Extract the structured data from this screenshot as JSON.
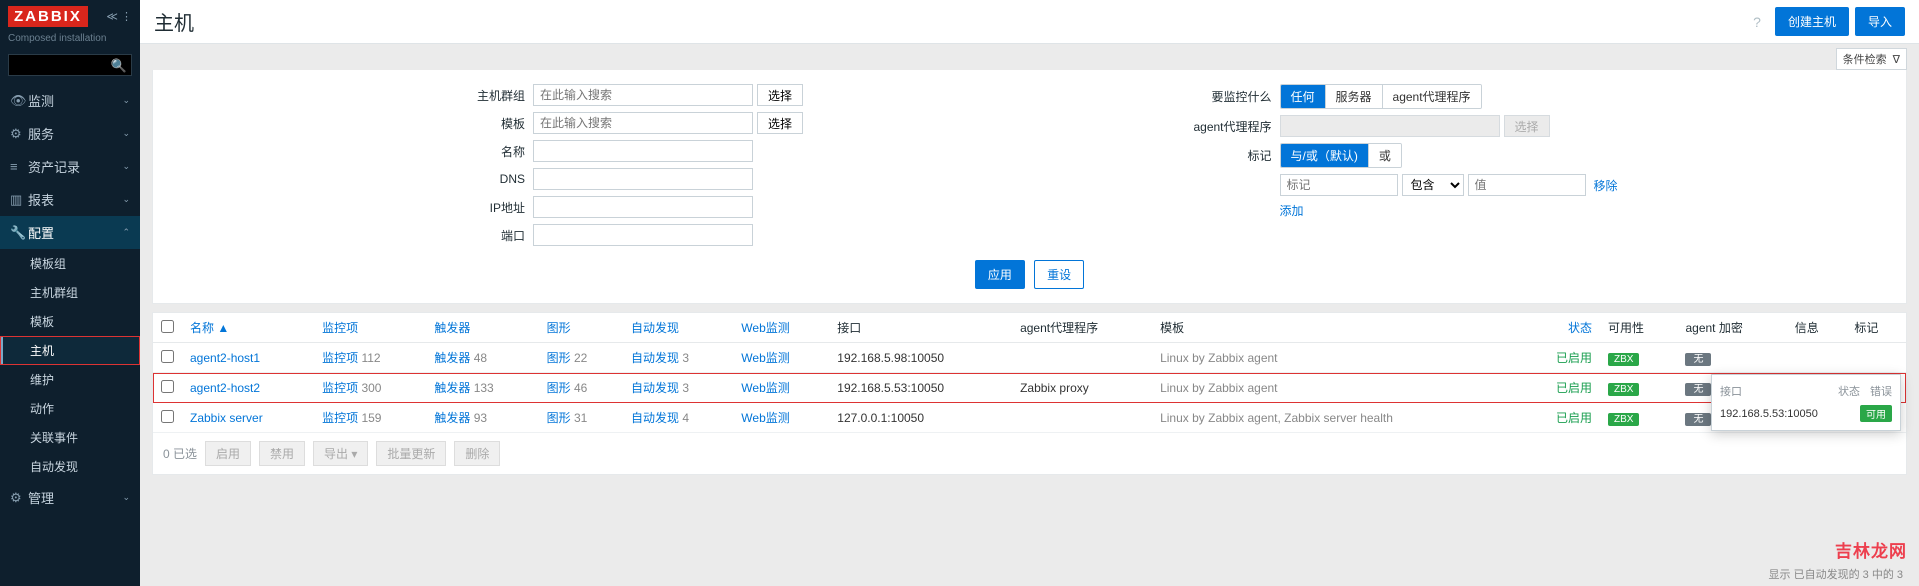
{
  "brand": {
    "logo": "ZABBIX",
    "subtitle": "Composed installation"
  },
  "sidebar": {
    "search_placeholder": "",
    "items": [
      {
        "icon": "👁",
        "label": "监测"
      },
      {
        "icon": "⚙",
        "label": "服务"
      },
      {
        "icon": "≡",
        "label": "资产记录"
      },
      {
        "icon": "▥",
        "label": "报表"
      },
      {
        "icon": "🔧",
        "label": "配置",
        "expanded": true
      },
      {
        "icon": "⚙",
        "label": "管理"
      }
    ],
    "config_children": [
      "模板组",
      "主机群组",
      "模板",
      "主机",
      "维护",
      "动作",
      "关联事件",
      "自动发现"
    ]
  },
  "header": {
    "title": "主机",
    "create": "创建主机",
    "import": "导入",
    "filter_label": "条件检索"
  },
  "filter": {
    "left": {
      "hostgroup": "主机群组",
      "placeholder": "在此输入搜索",
      "select": "选择",
      "template": "模板",
      "name": "名称",
      "dns": "DNS",
      "ip": "IP地址",
      "port": "端口"
    },
    "right": {
      "monitor": "要监控什么",
      "seg1": [
        "任何",
        "服务器",
        "agent代理程序"
      ],
      "proxy": "agent代理程序",
      "proxy_select": "选择",
      "tags": "标记",
      "seg2": [
        "与/或（默认)",
        "或"
      ],
      "tag_ph": "标记",
      "op": "包含",
      "val_ph": "值",
      "remove": "移除",
      "add": "添加"
    },
    "apply": "应用",
    "reset": "重设"
  },
  "table": {
    "cols": [
      "",
      "名称 ▲",
      "监控项",
      "触发器",
      "图形",
      "自动发现",
      "Web监测",
      "接口",
      "agent代理程序",
      "模板",
      "状态",
      "可用性",
      "agent 加密",
      "信息",
      "标记"
    ],
    "rows": [
      {
        "name": "agent2-host1",
        "items": [
          "监控项",
          "112"
        ],
        "trig": [
          "触发器",
          "48"
        ],
        "graph": [
          "图形",
          "22"
        ],
        "disc": [
          "自动发现",
          "3"
        ],
        "web": "Web监测",
        "iface": "192.168.5.98:10050",
        "proxy": "",
        "tmpl": "Linux by Zabbix agent",
        "status": "已启用",
        "avail": "ZBX",
        "enc": "无"
      },
      {
        "name": "agent2-host2",
        "items": [
          "监控项",
          "300"
        ],
        "trig": [
          "触发器",
          "133"
        ],
        "graph": [
          "图形",
          "46"
        ],
        "disc": [
          "自动发现",
          "3"
        ],
        "web": "Web监测",
        "iface": "192.168.5.53:10050",
        "proxy": "Zabbix proxy",
        "tmpl": "Linux by Zabbix agent",
        "status": "已启用",
        "avail": "ZBX",
        "enc": "无",
        "hl": true
      },
      {
        "name": "Zabbix server",
        "items": [
          "监控项",
          "159"
        ],
        "trig": [
          "触发器",
          "93"
        ],
        "graph": [
          "图形",
          "31"
        ],
        "disc": [
          "自动发现",
          "4"
        ],
        "web": "Web监测",
        "iface": "127.0.0.1:10050",
        "proxy": "",
        "tmpl": "Linux by Zabbix agent, Zabbix server health",
        "status": "已启用",
        "avail": "ZBX",
        "enc": "无"
      }
    ]
  },
  "footer": {
    "selected": "0 已选",
    "buttons": [
      "启用",
      "禁用",
      "导出 ▾",
      "批量更新",
      "删除"
    ]
  },
  "popup": {
    "h1": "接口",
    "h2": "状态",
    "h3": "错误",
    "iface": "192.168.5.53:10050",
    "status": "可用"
  },
  "summary": "显示 已自动发现的 3 中的 3",
  "watermark": "吉林龙网"
}
